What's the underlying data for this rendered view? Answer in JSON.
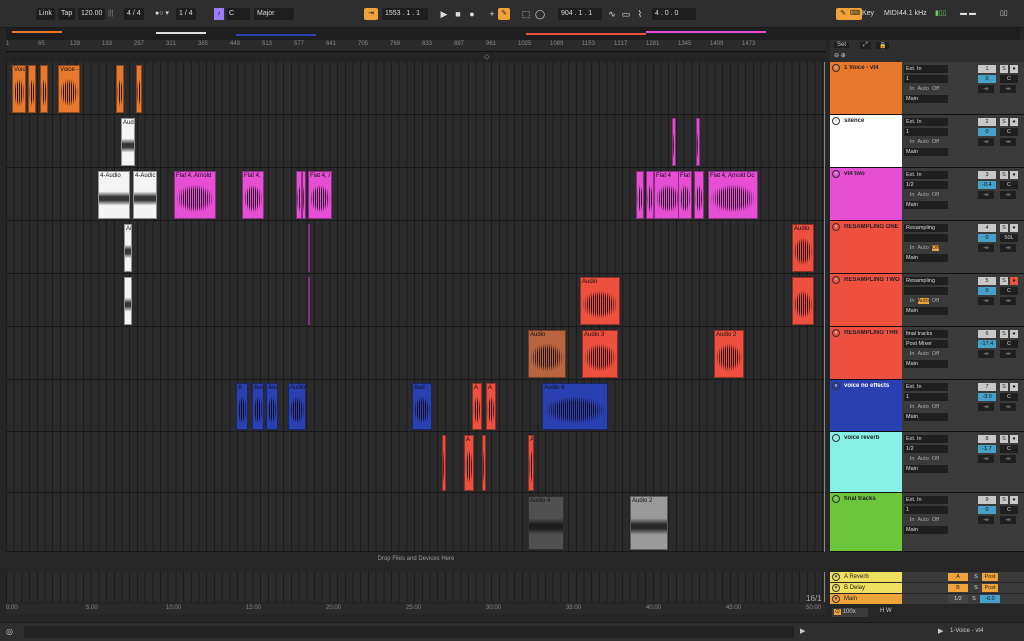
{
  "transport": {
    "link": "Link",
    "tap": "Tap",
    "tempo": "120.00",
    "time_sig_num": "4",
    "time_sig_den": "4",
    "quantize": "1 / 4",
    "key_root": "C",
    "scale": "Major",
    "arrangement_pos": "1553 .  1 .  1",
    "loop_start": "904 .  1 .  1",
    "loop_length": "4 .  0 .  0",
    "key_label": "Key",
    "midi_label": "MIDI",
    "sample_rate": "44.1 kHz"
  },
  "ruler": [
    "1",
    "65",
    "129",
    "193",
    "257",
    "321",
    "385",
    "449",
    "513",
    "577",
    "641",
    "705",
    "769",
    "833",
    "897",
    "961",
    "1025",
    "1089",
    "1153",
    "1217",
    "1281",
    "1345",
    "1409",
    "1473"
  ],
  "time_ruler": [
    "0:00",
    "5:00",
    "10:00",
    "15:00",
    "20:00",
    "25:00",
    "30:00",
    "35:00",
    "40:00",
    "45:00",
    "50:00"
  ],
  "drop_hint": "Drop Files and Devices Here",
  "set_label": "Set",
  "zoom": "100x",
  "bar_counter": "16/1",
  "status_track": "1-Voice - vt4",
  "tracks": [
    {
      "name": "1 Voice - vt4",
      "color": "#e8782e",
      "in": "Ext. In",
      "ch": "1",
      "num": "1",
      "vol": "0",
      "pan": "C",
      "out": "Main",
      "monitor": [
        "In",
        "Auto",
        "Off"
      ]
    },
    {
      "name": "silence",
      "color": "#ffffff",
      "in": "Ext. In",
      "ch": "1",
      "num": "2",
      "vol": "0",
      "pan": "C",
      "out": "Main",
      "monitor": [
        "In",
        "Auto",
        "Off"
      ]
    },
    {
      "name": "vt4 two",
      "color": "#e64fd4",
      "in": "Ext. In",
      "ch": "1/2",
      "num": "3",
      "vol": "-0.4",
      "pan": "C",
      "out": "Main",
      "monitor": [
        "In",
        "Auto",
        "Off"
      ]
    },
    {
      "name": "RESAMPLING ONE",
      "color": "#ee5040",
      "in": "Resampling",
      "ch": "",
      "num": "4",
      "vol": "0",
      "pan": "50L",
      "out": "Main",
      "monitor": [
        "In",
        "Auto",
        "Off"
      ]
    },
    {
      "name": "RESAMPLING TWO",
      "color": "#ee5040",
      "in": "Resampling",
      "ch": "",
      "num": "5",
      "vol": "0",
      "pan": "C",
      "out": "Main",
      "monitor": [
        "In",
        "Auto",
        "Off"
      ]
    },
    {
      "name": "RESAMPLING THR",
      "color": "#ee5040",
      "in": "final tracks",
      "ch": "Post Mixer",
      "num": "6",
      "vol": "-17.4",
      "pan": "C",
      "out": "Main",
      "monitor": [
        "In",
        "Auto",
        "Off"
      ]
    },
    {
      "name": "voice no effects",
      "color": "#2a3fb0",
      "in": "Ext. In",
      "ch": "1",
      "num": "7",
      "vol": "-3.0",
      "pan": "C",
      "out": "Main",
      "monitor": [
        "In",
        "Auto",
        "Off"
      ]
    },
    {
      "name": "voice reverb",
      "color": "#86f0e6",
      "in": "Ext. In",
      "ch": "1/2",
      "num": "8",
      "vol": "-1.7",
      "pan": "C",
      "out": "Main",
      "monitor": [
        "In",
        "Auto",
        "Off"
      ]
    },
    {
      "name": "final tracks",
      "color": "#6cc63c",
      "in": "Ext. In",
      "ch": "1",
      "num": "9",
      "vol": "0",
      "pan": "C",
      "out": "Main",
      "monitor": [
        "In",
        "Auto",
        "Off"
      ]
    }
  ],
  "returns": [
    {
      "name": "A Reverb",
      "color": "#f0e060",
      "letter": "A",
      "post": "Post"
    },
    {
      "name": "B Delay",
      "color": "#f0e060",
      "letter": "B",
      "post": "Post"
    },
    {
      "name": "Main",
      "color": "#f0a33b",
      "letter": "1/2",
      "vol": "-6.0"
    }
  ],
  "clip_labels": {
    "voice": "Voic",
    "voice2": "Voice -",
    "audio": "Audio",
    "four_audio": "4-Audio",
    "four_audic": "4-Audic",
    "flat": "Flat 4, Arnold",
    "flat4": "Flat 4,",
    "flat4a": "Flat 4, /",
    "flatdc": "Flat 4, Arnold Dc",
    "flat4s": "Flat 4",
    "aud": "Aud",
    "a": "A",
    "audio2": "Audio 2",
    "audio3": "Audio 3",
    "audio4": "Audio 4"
  }
}
